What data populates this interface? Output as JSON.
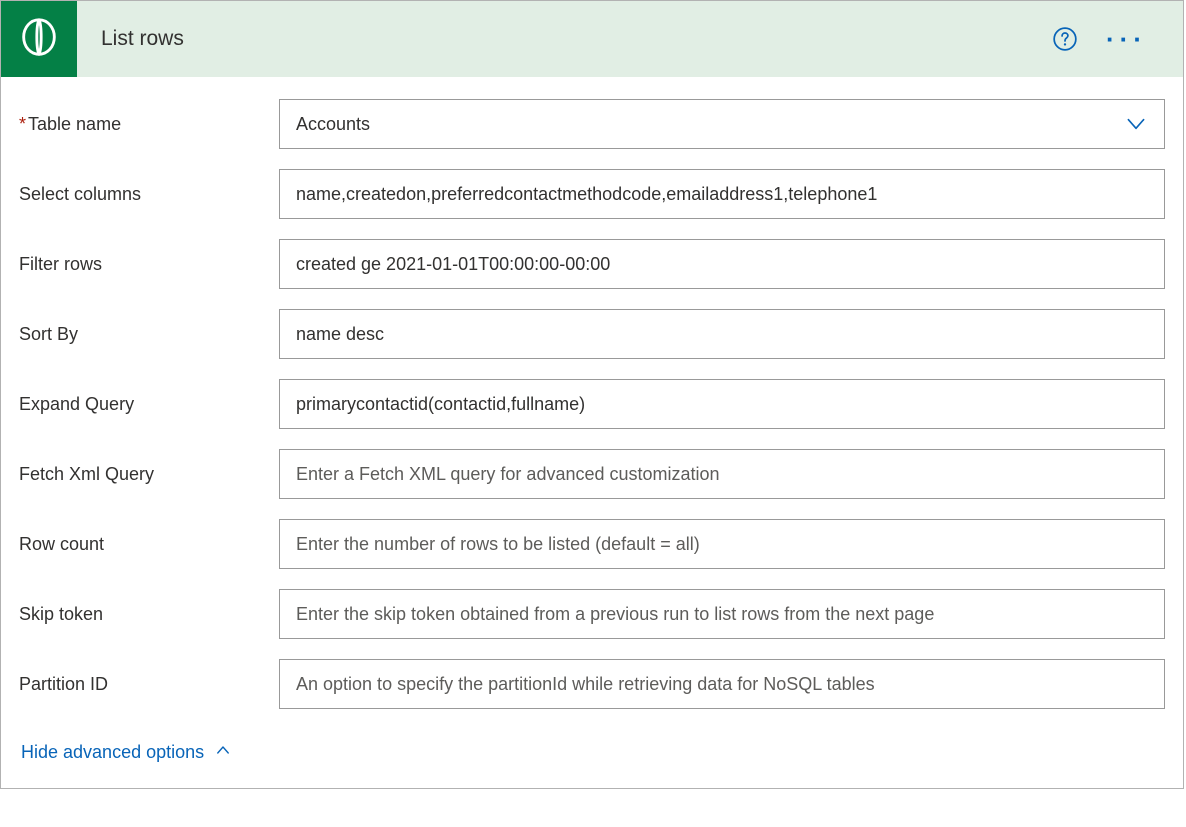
{
  "header": {
    "title": "List rows"
  },
  "fields": {
    "table_name": {
      "label": "Table name",
      "value": "Accounts",
      "required": true
    },
    "select_columns": {
      "label": "Select columns",
      "value": "name,createdon,preferredcontactmethodcode,emailaddress1,telephone1"
    },
    "filter_rows": {
      "label": "Filter rows",
      "value": "created ge 2021-01-01T00:00:00-00:00"
    },
    "sort_by": {
      "label": "Sort By",
      "value": "name desc"
    },
    "expand_query": {
      "label": "Expand Query",
      "value": "primarycontactid(contactid,fullname)"
    },
    "fetch_xml": {
      "label": "Fetch Xml Query",
      "placeholder": "Enter a Fetch XML query for advanced customization"
    },
    "row_count": {
      "label": "Row count",
      "placeholder": "Enter the number of rows to be listed (default = all)"
    },
    "skip_token": {
      "label": "Skip token",
      "placeholder": "Enter the skip token obtained from a previous run to list rows from the next page"
    },
    "partition_id": {
      "label": "Partition ID",
      "placeholder": "An option to specify the partitionId while retrieving data for NoSQL tables"
    }
  },
  "toggle": {
    "label": "Hide advanced options"
  }
}
